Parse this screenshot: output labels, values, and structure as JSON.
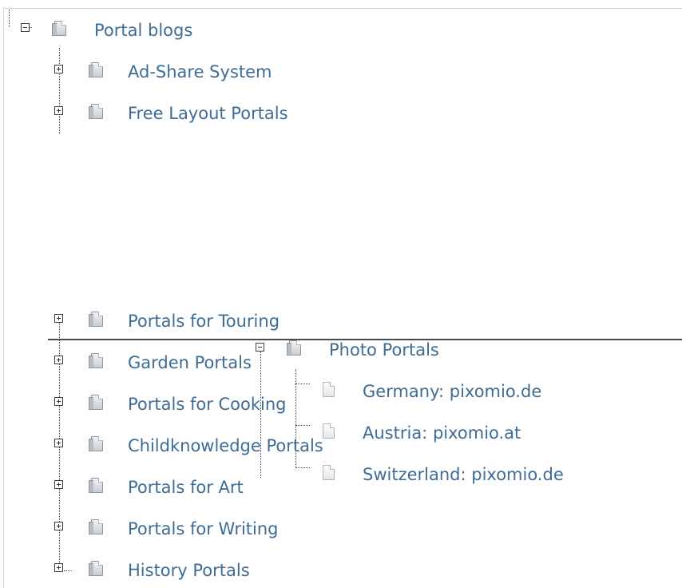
{
  "tree": {
    "root": {
      "label": "Portal blogs",
      "expanded": true
    },
    "children": [
      {
        "label": "Ad-Share System"
      },
      {
        "label": "Free Layout Portals"
      },
      {
        "label": "Portals for Touring"
      },
      {
        "label": "Garden Portals"
      },
      {
        "label": "Portals for Cooking"
      },
      {
        "label": "Childknowledge Portals"
      },
      {
        "label": "Portals for Art"
      },
      {
        "label": "Portals for Writing"
      },
      {
        "label": "History Portals"
      }
    ]
  },
  "drag": {
    "label": "Photo Portals",
    "expanded": true,
    "children": [
      {
        "label": "Germany: pixomio.de"
      },
      {
        "label": "Austria: pixomio.at"
      },
      {
        "label": "Switzerland: pixomio.de"
      }
    ]
  }
}
